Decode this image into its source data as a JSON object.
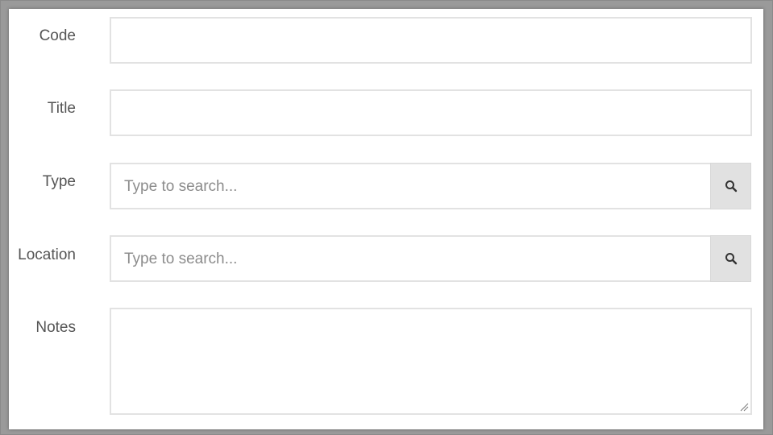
{
  "form": {
    "code": {
      "label": "Code",
      "value": ""
    },
    "title": {
      "label": "Title",
      "value": ""
    },
    "type": {
      "label": "Type",
      "placeholder": "Type to search..."
    },
    "location": {
      "label": "Location",
      "placeholder": "Type to search..."
    },
    "notes": {
      "label": "Notes",
      "value": ""
    }
  },
  "icons": {
    "search": "search-icon",
    "resize": "resize-grip-icon"
  },
  "colors": {
    "label_text": "#555555",
    "placeholder_text": "#8c8c8c",
    "field_border": "#e2e2e2",
    "search_button_bg": "#e1e1e1"
  }
}
